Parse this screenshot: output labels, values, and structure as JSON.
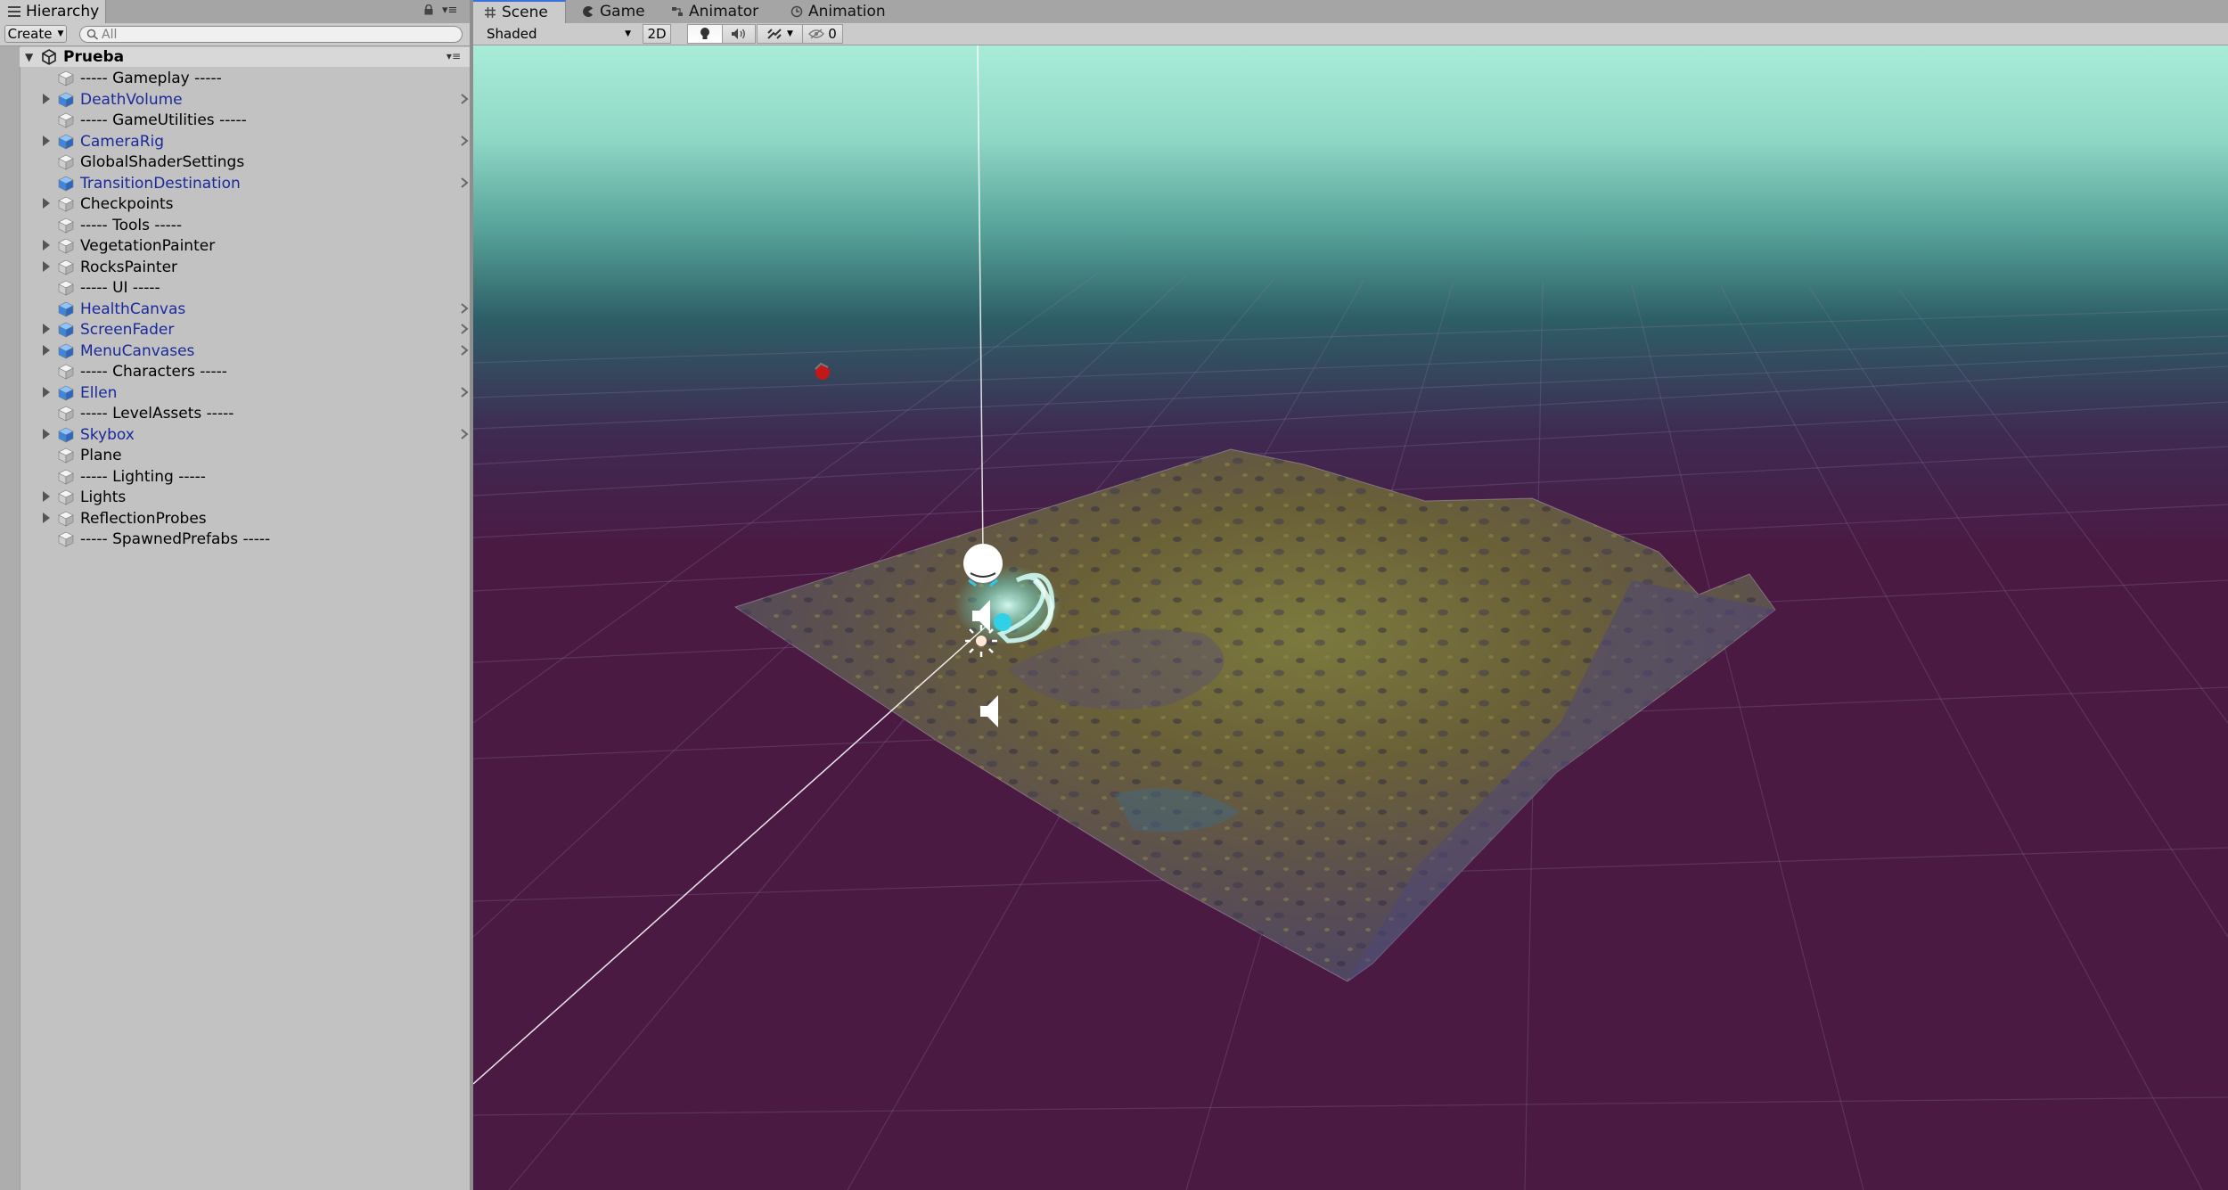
{
  "hierarchy": {
    "tab_label": "Hierarchy",
    "create_label": "Create",
    "search_placeholder": "All",
    "scene_name": "Prueba",
    "items": [
      {
        "label": "----- Gameplay -----",
        "kind": "plain",
        "foldout": false,
        "chevron": false
      },
      {
        "label": "DeathVolume",
        "kind": "prefab",
        "foldout": true,
        "chevron": true
      },
      {
        "label": "----- GameUtilities -----",
        "kind": "plain",
        "foldout": false,
        "chevron": false
      },
      {
        "label": "CameraRig",
        "kind": "prefab",
        "foldout": true,
        "chevron": true
      },
      {
        "label": "GlobalShaderSettings",
        "kind": "plain",
        "foldout": false,
        "chevron": false
      },
      {
        "label": "TransitionDestination",
        "kind": "prefab",
        "foldout": false,
        "chevron": true
      },
      {
        "label": "Checkpoints",
        "kind": "plain",
        "foldout": true,
        "chevron": false
      },
      {
        "label": "----- Tools -----",
        "kind": "plain",
        "foldout": false,
        "chevron": false
      },
      {
        "label": "VegetationPainter",
        "kind": "plain",
        "foldout": true,
        "chevron": false
      },
      {
        "label": "RocksPainter",
        "kind": "plain",
        "foldout": true,
        "chevron": false
      },
      {
        "label": "----- UI -----",
        "kind": "plain",
        "foldout": false,
        "chevron": false
      },
      {
        "label": "HealthCanvas",
        "kind": "prefab",
        "foldout": false,
        "chevron": true
      },
      {
        "label": "ScreenFader",
        "kind": "prefab",
        "foldout": true,
        "chevron": true
      },
      {
        "label": "MenuCanvases",
        "kind": "prefab",
        "foldout": true,
        "chevron": true
      },
      {
        "label": "----- Characters -----",
        "kind": "plain",
        "foldout": false,
        "chevron": false
      },
      {
        "label": "Ellen",
        "kind": "prefab",
        "foldout": true,
        "chevron": true
      },
      {
        "label": "----- LevelAssets -----",
        "kind": "plain",
        "foldout": false,
        "chevron": false
      },
      {
        "label": "Skybox",
        "kind": "prefab",
        "foldout": true,
        "chevron": true
      },
      {
        "label": "Plane",
        "kind": "plain",
        "foldout": false,
        "chevron": false
      },
      {
        "label": "----- Lighting -----",
        "kind": "plain",
        "foldout": false,
        "chevron": false
      },
      {
        "label": "Lights",
        "kind": "plain",
        "foldout": true,
        "chevron": false
      },
      {
        "label": "ReflectionProbes",
        "kind": "plain",
        "foldout": true,
        "chevron": false
      },
      {
        "label": "----- SpawnedPrefabs -----",
        "kind": "plain",
        "foldout": false,
        "chevron": false
      }
    ]
  },
  "scene_view": {
    "tabs": [
      {
        "label": "Scene",
        "icon": "grid-icon",
        "active": true
      },
      {
        "label": "Game",
        "icon": "pacman-icon",
        "active": false
      },
      {
        "label": "Animator",
        "icon": "animator-icon",
        "active": false
      },
      {
        "label": "Animation",
        "icon": "clock-icon",
        "active": false
      }
    ],
    "shading_mode": "Shaded",
    "mode_2d_label": "2D",
    "hidden_count": "0"
  },
  "colors": {
    "sky_top": "#a8ecd8",
    "sky_mid": "#3f7d78",
    "floor": "#4a1a43",
    "prefab_text": "#1a2a9a",
    "active_tab_accent": "#3a72d9"
  }
}
